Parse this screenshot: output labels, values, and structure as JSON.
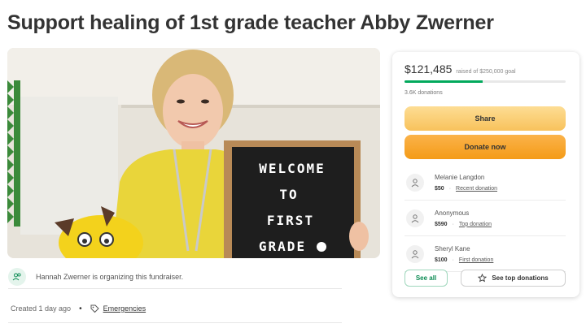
{
  "page": {
    "title": "Support healing of 1st grade teacher Abby Zwerner"
  },
  "hero": {
    "board_lines": [
      "WELCOME",
      "TO",
      "FIRST",
      "GRADE"
    ]
  },
  "organizer": {
    "text": "Hannah Zwerner is organizing this fundraiser.",
    "icon": "people-icon"
  },
  "meta": {
    "created": "Created 1 day ago",
    "separator": "•",
    "category": "Emergencies",
    "tag_icon": "tag-icon"
  },
  "card": {
    "amount": "$121,485",
    "goal_text": "raised of $250,000 goal",
    "progress_fraction": 0.486,
    "donation_count": "3.6K donations",
    "share_label": "Share",
    "donate_label": "Donate now",
    "donors": [
      {
        "name": "Melanie Langdon",
        "amount": "$50",
        "label": "Recent donation"
      },
      {
        "name": "Anonymous",
        "amount": "$590",
        "label": "Top donation"
      },
      {
        "name": "Sheryl Kane",
        "amount": "$100",
        "label": "First donation"
      }
    ],
    "see_all_label": "See all",
    "see_top_label": "See top donations"
  },
  "colors": {
    "accent_green": "#02a95c",
    "share_yellow": "#f8c25c",
    "donate_orange": "#f49b17"
  }
}
